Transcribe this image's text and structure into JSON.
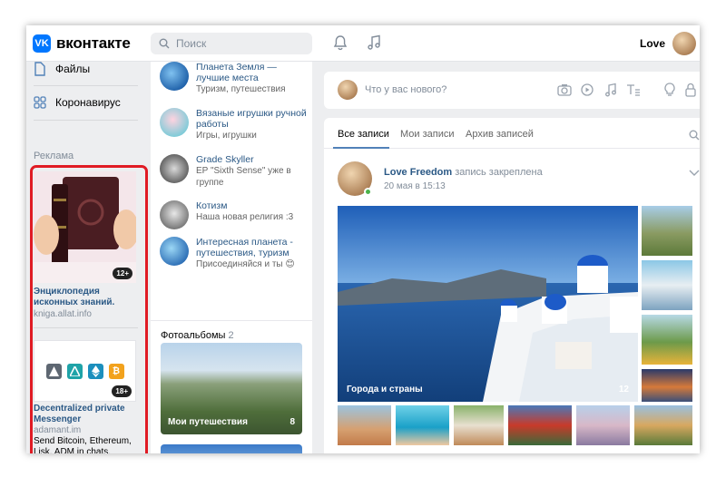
{
  "header": {
    "logo_text": "вконтакте",
    "search_placeholder": "Поиск",
    "user_name": "Love"
  },
  "left_nav": {
    "files": "Файлы",
    "corona": "Коронавирус",
    "ads_label": "Реклама"
  },
  "ads": [
    {
      "title": "Энциклопедия исконных знаний.",
      "site": "kniga.allat.info",
      "count": "12+"
    },
    {
      "title": "Decentralized private Messenger",
      "site": "adamant.im",
      "count": "18+",
      "text": "Send Bitcoin, Ethereum, Lisk, ADM in chats. Anonymously. Open source."
    }
  ],
  "communities": [
    {
      "title": "Планета Земля — лучшие места",
      "sub": "Туризм, путешествия"
    },
    {
      "title": "Вязаные игрушки ручной работы",
      "sub": "Игры, игрушки"
    },
    {
      "title": "Grade Skyller",
      "sub": "EP \"Sixth Sense\" уже в группе"
    },
    {
      "title": "Котизм",
      "sub": "Наша новая религия :3"
    },
    {
      "title": "Интересная планета - путешествия, туризм",
      "sub": "Присоединяйся и ты 😊"
    }
  ],
  "albums": {
    "heading": "Фотоальбомы",
    "count": "2",
    "items": [
      {
        "label": "Мои путешествия",
        "count": "8"
      }
    ]
  },
  "composer": {
    "placeholder": "Что у вас нового?"
  },
  "tabs": [
    "Все записи",
    "Мои записи",
    "Архив записей"
  ],
  "post": {
    "author": "Love Freedom",
    "action": "запись закреплена",
    "date": "20 мая в 15:13",
    "photo_label": "Города и страны",
    "photo_count": "12"
  },
  "icons": [
    "vk-logo-icon",
    "search-icon",
    "bell-icon",
    "music-icon",
    "file-icon",
    "coronavirus-icon",
    "camera-icon",
    "video-icon",
    "music-icon",
    "text-icon",
    "bulb-icon",
    "lock-icon",
    "chevron-down-icon"
  ],
  "colors": {
    "accent": "#0077ff",
    "link": "#2a5885",
    "highlight": "#e01b24"
  }
}
